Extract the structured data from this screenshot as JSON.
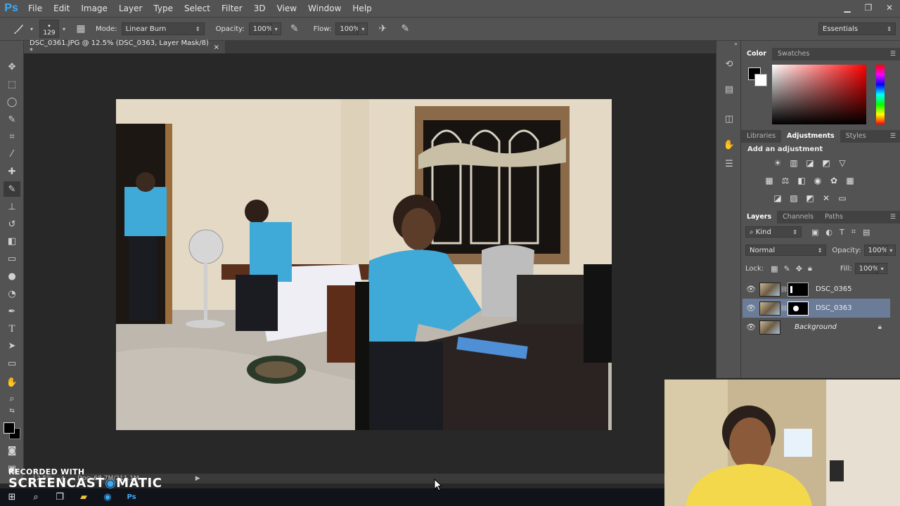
{
  "app": {
    "logo": "Ps"
  },
  "menu": [
    "File",
    "Edit",
    "Image",
    "Layer",
    "Type",
    "Select",
    "Filter",
    "3D",
    "View",
    "Window",
    "Help"
  ],
  "options": {
    "brush_size": "129",
    "mode_label": "Mode:",
    "mode_value": "Linear Burn",
    "opacity_label": "Opacity:",
    "opacity_value": "100%",
    "flow_label": "Flow:",
    "flow_value": "100%",
    "workspace": "Essentials"
  },
  "document": {
    "tab_title": "DSC_0361.JPG @ 12.5% (DSC_0363, Layer Mask/8) *",
    "close": "×"
  },
  "status": {
    "zoom": "12.5%",
    "doc_info": "Doc: 68.7M/211.1M"
  },
  "color_panel": {
    "tabs": [
      "Color",
      "Swatches"
    ],
    "active": 0
  },
  "adjustments_panel": {
    "tabs": [
      "Libraries",
      "Adjustments",
      "Styles"
    ],
    "active": 1,
    "title": "Add an adjustment"
  },
  "layers_panel": {
    "tabs": [
      "Layers",
      "Channels",
      "Paths"
    ],
    "active": 0,
    "filter_kind": "Kind",
    "blend_mode": "Normal",
    "opacity_label": "Opacity:",
    "opacity_value": "100%",
    "lock_label": "Lock:",
    "fill_label": "Fill:",
    "fill_value": "100%",
    "layers": [
      {
        "name": "DSC_0365",
        "has_mask": true,
        "selected": false
      },
      {
        "name": "DSC_0363",
        "has_mask": true,
        "selected": true
      },
      {
        "name": "Background",
        "has_mask": false,
        "selected": false,
        "locked": true
      }
    ]
  },
  "watermark": {
    "line1": "RECORDED WITH",
    "line2_a": "SCREENCAST",
    "line2_b": "MATIC"
  },
  "colors": {
    "menubar": "#535353",
    "canvas_bg": "#282828",
    "selection": "#6b7c99",
    "ps_blue": "#3fa9f5"
  }
}
